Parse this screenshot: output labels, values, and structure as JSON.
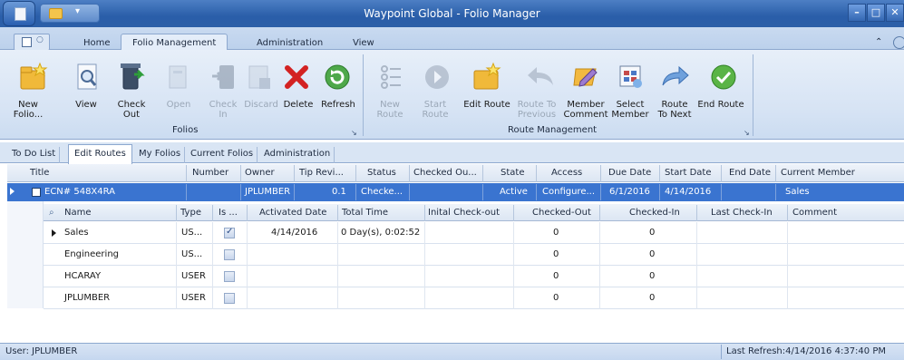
{
  "window": {
    "title": "Waypoint Global - Folio Manager"
  },
  "ribbon_tabs": [
    "Home",
    "Folio Management",
    "Administration",
    "View"
  ],
  "ribbon": {
    "folios_group": {
      "label": "Folios",
      "buttons": [
        {
          "label_lines": [
            "New Folio..."
          ],
          "enabled": true
        },
        {
          "label_lines": [
            "View"
          ],
          "enabled": true
        },
        {
          "label_lines": [
            "Check",
            "Out"
          ],
          "enabled": true
        },
        {
          "label_lines": [
            "Open"
          ],
          "enabled": false
        },
        {
          "label_lines": [
            "Check",
            "In"
          ],
          "enabled": false
        },
        {
          "label_lines": [
            "Discard"
          ],
          "enabled": false
        },
        {
          "label_lines": [
            "Delete"
          ],
          "enabled": true
        },
        {
          "label_lines": [
            "Refresh"
          ],
          "enabled": true
        }
      ]
    },
    "route_group": {
      "label": "Route Management",
      "buttons": [
        {
          "label_lines": [
            "New Route"
          ],
          "enabled": false
        },
        {
          "label_lines": [
            "Start",
            "Route"
          ],
          "enabled": false
        },
        {
          "label_lines": [
            "Edit Route"
          ],
          "enabled": true
        },
        {
          "label_lines": [
            "Route To",
            "Previous"
          ],
          "enabled": false
        },
        {
          "label_lines": [
            "Member",
            "Comment"
          ],
          "enabled": true
        },
        {
          "label_lines": [
            "Select",
            "Member"
          ],
          "enabled": true
        },
        {
          "label_lines": [
            "Route",
            "To Next"
          ],
          "enabled": true
        },
        {
          "label_lines": [
            "End Route"
          ],
          "enabled": true
        }
      ]
    }
  },
  "doc_tabs": [
    "To Do List",
    "Edit Routes",
    "My Folios",
    "Current Folios",
    "Administration"
  ],
  "grid": {
    "columns": [
      "Title",
      "Number",
      "Owner",
      "Tip Revi...",
      "Status",
      "Checked Ou...",
      "State",
      "Access",
      "Due Date",
      "Start Date",
      "End Date",
      "Current Member"
    ],
    "main_row": {
      "title": "ECN# 548X4RA",
      "number": "",
      "owner": "JPLUMBER",
      "tip_revision": "0.1",
      "status": "Checke...",
      "checked_out": "",
      "state": "Active",
      "access": "Configure...",
      "due_date": "6/1/2016",
      "start_date": "4/14/2016",
      "end_date": "",
      "current_member": "Sales"
    },
    "sub_columns": [
      "Name",
      "Type",
      "Is ...",
      "Activated Date",
      "Total Time",
      "Inital Check-out",
      "Checked-Out",
      "Checked-In",
      "Last Check-In",
      "Comment"
    ],
    "sub_rows": [
      {
        "name": "Sales",
        "type": "US...",
        "is_checked": true,
        "activated_date": "4/14/2016",
        "total_time": "0 Day(s), 0:02:52",
        "initial_checkout": "",
        "checked_out": "0",
        "checked_in": "0",
        "last_checkin": "",
        "comment": ""
      },
      {
        "name": "Engineering",
        "type": "US...",
        "is_checked": false,
        "activated_date": "",
        "total_time": "",
        "initial_checkout": "",
        "checked_out": "0",
        "checked_in": "0",
        "last_checkin": "",
        "comment": ""
      },
      {
        "name": "HCARAY",
        "type": "USER",
        "is_checked": false,
        "activated_date": "",
        "total_time": "",
        "initial_checkout": "",
        "checked_out": "0",
        "checked_in": "0",
        "last_checkin": "",
        "comment": ""
      },
      {
        "name": "JPLUMBER",
        "type": "USER",
        "is_checked": false,
        "activated_date": "",
        "total_time": "",
        "initial_checkout": "",
        "checked_out": "0",
        "checked_in": "0",
        "last_checkin": "",
        "comment": ""
      }
    ]
  },
  "status_bar": {
    "user": "User: JPLUMBER",
    "last_refresh": "Last Refresh:4/14/2016 4:37:40 PM"
  },
  "icons": {
    "orb": "app-orb-icon",
    "qat_folder": "folder-icon",
    "new_folio": "new-folder-icon",
    "view": "magnifier-document-icon",
    "check_out": "check-out-icon",
    "delete": "red-x-icon",
    "refresh": "green-refresh-icon",
    "end_route": "green-check-icon"
  },
  "colors": {
    "titlebar": "#2a5ea9",
    "selected_row": "#3a74d0",
    "ribbon_bg": "#d6e3f4"
  }
}
